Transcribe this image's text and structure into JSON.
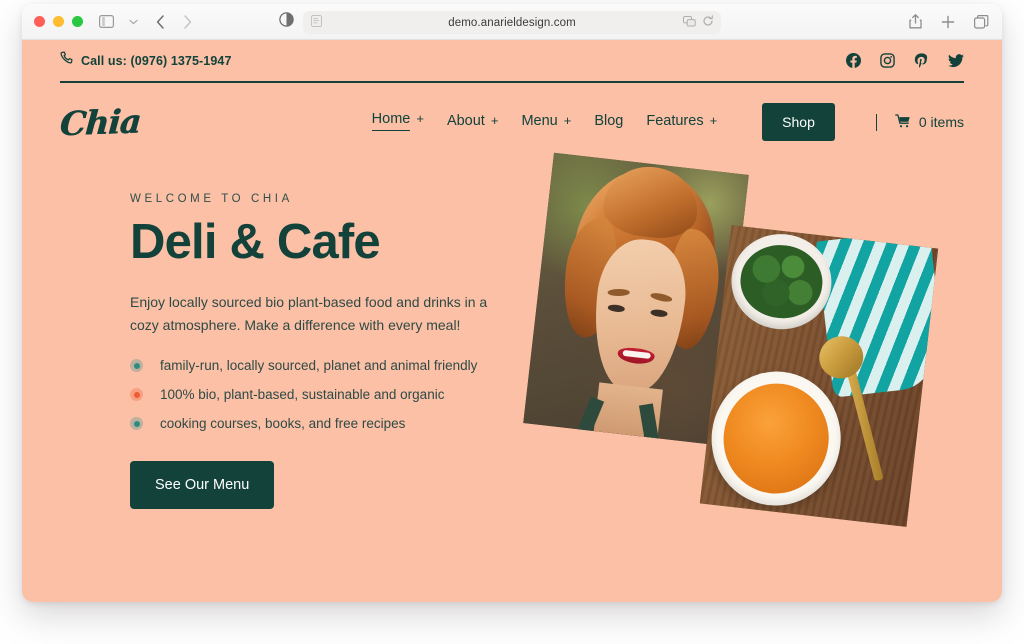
{
  "browser": {
    "url": "demo.anarieldesign.com",
    "icons": {
      "sidebar": "sidebar-toggle-icon",
      "sidebar_chevron": "chevron-down-icon",
      "back": "back-arrow-icon",
      "forward": "forward-arrow-icon",
      "contrast": "contrast-icon",
      "reader": "reader-view-icon",
      "translate": "translate-icon",
      "reload": "reload-icon",
      "share": "share-icon",
      "new_tab": "plus-icon",
      "tabs": "tab-overview-icon"
    }
  },
  "topbar": {
    "phone_icon": "phone-icon",
    "phone_text": "Call us: (0976) 1375-1947",
    "socials": [
      {
        "name": "facebook-icon",
        "label": "Facebook"
      },
      {
        "name": "instagram-icon",
        "label": "Instagram"
      },
      {
        "name": "pinterest-icon",
        "label": "Pinterest"
      },
      {
        "name": "twitter-icon",
        "label": "Twitter"
      }
    ]
  },
  "header": {
    "logo": "Chia",
    "nav": [
      {
        "label": "Home",
        "plus": "+",
        "active": true
      },
      {
        "label": "About",
        "plus": "+",
        "active": false
      },
      {
        "label": "Menu",
        "plus": "+",
        "active": false
      },
      {
        "label": "Blog",
        "plus": "",
        "active": false
      },
      {
        "label": "Features",
        "plus": "+",
        "active": false
      }
    ],
    "shop_label": "Shop",
    "cart_icon": "shopping-cart-icon",
    "cart_label": "0 items"
  },
  "hero": {
    "eyebrow": "WELCOME TO CHIA",
    "title": "Deli & Cafe",
    "description": "Enjoy locally sourced bio plant-based food and drinks in a cozy atmosphere. Make a difference with every meal!",
    "list": [
      {
        "text": "family-run, locally sourced, planet and animal friendly",
        "color": "#2e8b83"
      },
      {
        "text": "100% bio, plant-based, sustainable and organic",
        "color": "#ef5b32"
      },
      {
        "text": "cooking courses, books, and free recipes",
        "color": "#2e8b83"
      }
    ],
    "cta_label": "See Our Menu",
    "images": [
      {
        "name": "portrait-photo",
        "alt": "Smiling red-haired woman with freckles"
      },
      {
        "name": "food-photo",
        "alt": "Orange soup bowl flat-lay with herbs, gold spoon and teal striped towel"
      }
    ]
  },
  "colors": {
    "background": "#fbc0a6",
    "dark_green": "#12423a",
    "accent_teal": "#2e8b83",
    "accent_orange": "#ef5b32"
  }
}
